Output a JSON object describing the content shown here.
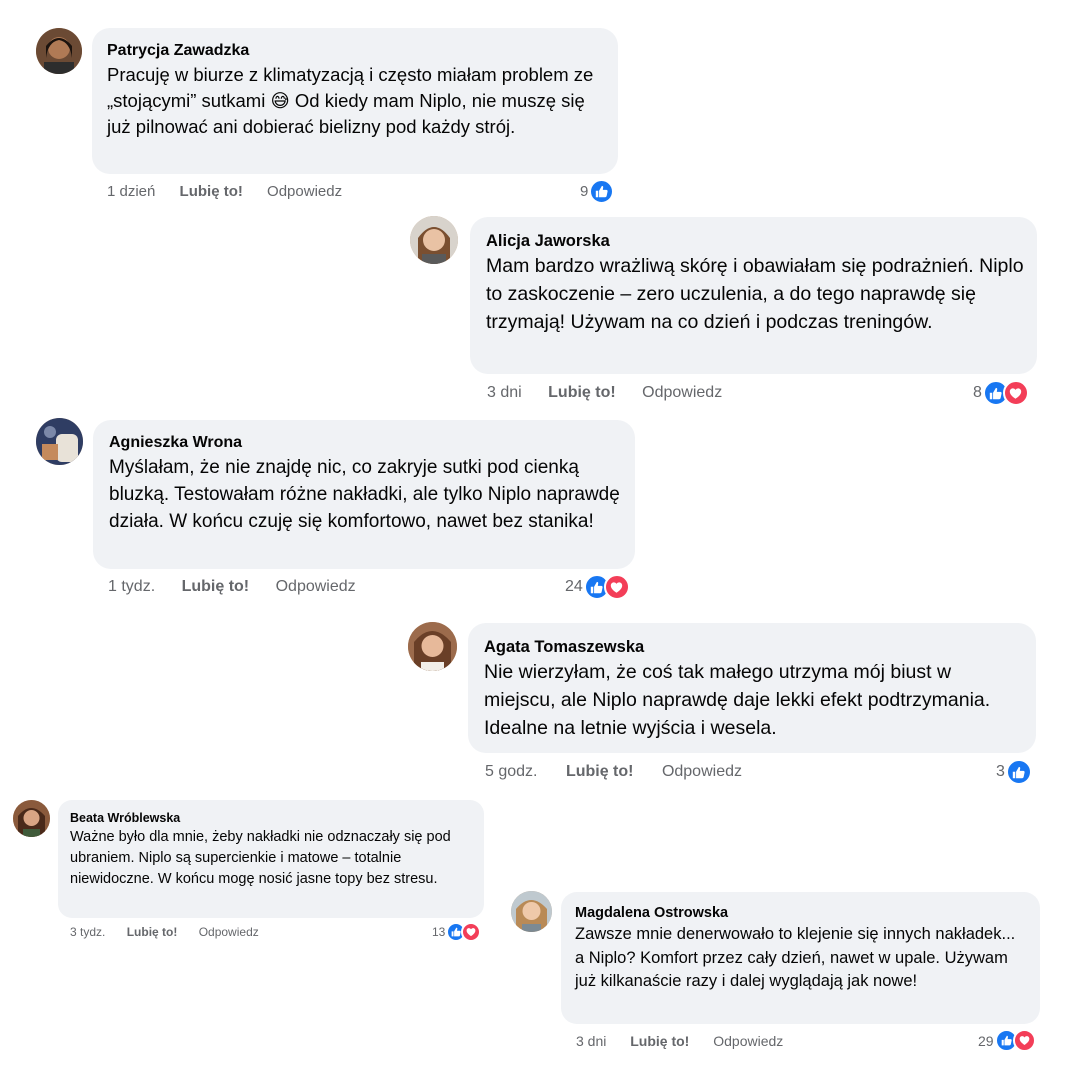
{
  "colors": {
    "bubble": "#f0f2f5",
    "meta_text": "#65676b",
    "like_blue": "#1877f2",
    "love_red": "#f33e58"
  },
  "comments": [
    {
      "author": "Patrycja Zawadzka",
      "text_before_emoji": "Pracuję w biurze z klimatyzacją i często miałam problem ze „stojącymi” sutkami",
      "emoji": "😅",
      "text_after_emoji": " Od kiedy mam Niplo, nie muszę się już pilnować ani dobierać bielizny pod każdy strój.",
      "time": "1 dzień",
      "like_label": "Lubię to!",
      "reply_label": "Odpowiedz",
      "reaction_count": "9",
      "reactions": [
        "like-icon"
      ]
    },
    {
      "author": "Alicja Jaworska",
      "text": "Mam bardzo wrażliwą skórę i obawiałam się podrażnień. Niplo to zaskoczenie – zero uczulenia, a do tego naprawdę się trzymają! Używam na co dzień i podczas treningów.",
      "time": "3 dni",
      "like_label": "Lubię to!",
      "reply_label": "Odpowiedz",
      "reaction_count": "8",
      "reactions": [
        "like-icon",
        "love-icon"
      ]
    },
    {
      "author": "Agnieszka Wrona",
      "text": "Myślałam, że nie znajdę nic, co zakryje sutki pod cienką bluzką. Testowałam różne nakładki, ale tylko Niplo naprawdę działa. W końcu czuję się komfortowo, nawet bez stanika!",
      "time": "1 tydz.",
      "like_label": "Lubię to!",
      "reply_label": "Odpowiedz",
      "reaction_count": "24",
      "reactions": [
        "like-icon",
        "love-icon"
      ]
    },
    {
      "author": "Agata Tomaszewska",
      "text": "Nie wierzyłam, że coś tak małego utrzyma mój biust w miejscu, ale Niplo naprawdę daje lekki efekt podtrzymania. Idealne na letnie wyjścia i wesela.",
      "time": "5 godz.",
      "like_label": "Lubię to!",
      "reply_label": "Odpowiedz",
      "reaction_count": "3",
      "reactions": [
        "like-icon"
      ]
    },
    {
      "author": "Beata Wróblewska",
      "text": "Ważne było dla mnie, żeby nakładki nie odznaczały się pod ubraniem. Niplo są supercienkie i matowe – totalnie niewidoczne. W końcu mogę nosić jasne topy bez stresu.",
      "time": "3 tydz.",
      "like_label": "Lubię to!",
      "reply_label": "Odpowiedz",
      "reaction_count": "13",
      "reactions": [
        "like-icon",
        "love-icon"
      ]
    },
    {
      "author": "Magdalena Ostrowska",
      "text": "Zawsze mnie denerwowało to klejenie się innych nakładek... a Niplo? Komfort przez cały dzień, nawet w upale. Używam już kilkanaście razy i dalej wyglądają jak nowe!",
      "time": "3 dni",
      "like_label": "Lubię to!",
      "reply_label": "Odpowiedz",
      "reaction_count": "29",
      "reactions": [
        "like-icon",
        "love-icon"
      ]
    }
  ]
}
